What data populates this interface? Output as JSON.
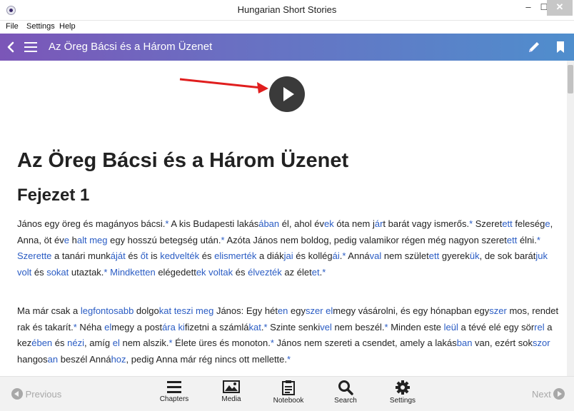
{
  "window": {
    "title": "Hungarian Short Stories",
    "min_glyph": "–",
    "max_glyph": "☐",
    "close_glyph": "✕"
  },
  "menu": {
    "items": [
      "File",
      "Settings",
      "Help"
    ]
  },
  "header": {
    "title": "Az Öreg Bácsi és a Három Üzenet",
    "gradient_start": "#7b56b8",
    "gradient_end": "#4f8ecd"
  },
  "content": {
    "story_title": "Az Öreg Bácsi és a Három Üzenet",
    "chapter_title": "Fejezet 1",
    "paragraphs": [
      [
        {
          "t": "János egy öreg és magányos bácsi."
        },
        {
          "t": "*",
          "h": true
        },
        {
          "t": " A kis Budapesti lakás"
        },
        {
          "t": "ában",
          "h": true
        },
        {
          "t": " él, ahol év"
        },
        {
          "t": "ek",
          "h": true
        },
        {
          "t": " óta nem j"
        },
        {
          "t": "ár",
          "h": true
        },
        {
          "t": "t barát vagy ismerős."
        },
        {
          "t": "*",
          "h": true
        },
        {
          "t": " Szeret"
        },
        {
          "t": "ett",
          "h": true
        },
        {
          "t": " feleség"
        },
        {
          "t": "e",
          "h": true
        },
        {
          "t": ", Anna, öt év"
        },
        {
          "t": "e",
          "h": true
        },
        {
          "t": " h"
        },
        {
          "t": "alt meg",
          "h": true
        },
        {
          "t": " egy hosszú betegség után."
        },
        {
          "t": "*",
          "h": true
        },
        {
          "t": " Azóta János nem boldog, pedig valamikor régen még nagyon"
        },
        {
          "t": " szeret"
        },
        {
          "t": "ett",
          "h": true
        },
        {
          "t": " élni."
        },
        {
          "t": "*",
          "h": true
        },
        {
          "t": " "
        },
        {
          "t": "Szerette",
          "h": true
        },
        {
          "t": " a tanári munk"
        },
        {
          "t": "áját",
          "h": true
        },
        {
          "t": " és "
        },
        {
          "t": "őt",
          "h": true
        },
        {
          "t": " is "
        },
        {
          "t": "kedvelték",
          "h": true
        },
        {
          "t": " és "
        },
        {
          "t": "elismerték",
          "h": true
        },
        {
          "t": " a diák"
        },
        {
          "t": "jai",
          "h": true
        },
        {
          "t": " és kollég"
        },
        {
          "t": "ái",
          "h": true
        },
        {
          "t": "."
        },
        {
          "t": "*",
          "h": true
        },
        {
          "t": " Anná"
        },
        {
          "t": "val",
          "h": true
        },
        {
          "t": " nem szület"
        },
        {
          "t": "ett",
          "h": true
        },
        {
          "t": " gyerek"
        },
        {
          "t": "ük",
          "h": true
        },
        {
          "t": ", de sok barát"
        },
        {
          "t": "juk volt",
          "h": true
        },
        {
          "t": " és "
        },
        {
          "t": "sokat",
          "h": true
        },
        {
          "t": " utaztak."
        },
        {
          "t": "*",
          "h": true
        },
        {
          "t": " "
        },
        {
          "t": "Mindketten",
          "h": true
        },
        {
          "t": " elégedett"
        },
        {
          "t": "ek voltak",
          "h": true
        },
        {
          "t": " és "
        },
        {
          "t": "élvezték",
          "h": true
        },
        {
          "t": " az élet"
        },
        {
          "t": "et",
          "h": true
        },
        {
          "t": "."
        },
        {
          "t": "*",
          "h": true
        }
      ],
      [
        {
          "t": "Ma már csak a "
        },
        {
          "t": "legfontosabb",
          "h": true
        },
        {
          "t": " dolgo"
        },
        {
          "t": "kat teszi meg",
          "h": true
        },
        {
          "t": " János: Egy hét"
        },
        {
          "t": "en",
          "h": true
        },
        {
          "t": " egy"
        },
        {
          "t": "szer el",
          "h": true
        },
        {
          "t": "megy vásárolni, és egy hónapban egy"
        },
        {
          "t": "szer",
          "h": true
        },
        {
          "t": " mos,"
        },
        {
          "t": " rendet rak és takarít."
        },
        {
          "t": "*",
          "h": true
        },
        {
          "t": " Néha "
        },
        {
          "t": "el",
          "h": true
        },
        {
          "t": "megy a post"
        },
        {
          "t": "ára",
          "h": true
        },
        {
          "t": " "
        },
        {
          "t": "ki",
          "h": true
        },
        {
          "t": "fizetni a számlá"
        },
        {
          "t": "kat",
          "h": true
        },
        {
          "t": "."
        },
        {
          "t": "*",
          "h": true
        },
        {
          "t": " Szinte senki"
        },
        {
          "t": "vel",
          "h": true
        },
        {
          "t": " nem beszél."
        },
        {
          "t": "*",
          "h": true
        },
        {
          "t": " Minden este "
        },
        {
          "t": "leül",
          "h": true
        },
        {
          "t": " a tévé elé"
        },
        {
          "t": " egy sör"
        },
        {
          "t": "rel",
          "h": true
        },
        {
          "t": " a kez"
        },
        {
          "t": "ében",
          "h": true
        },
        {
          "t": " és "
        },
        {
          "t": "nézi",
          "h": true
        },
        {
          "t": ", amíg "
        },
        {
          "t": "el",
          "h": true
        },
        {
          "t": " nem alszik."
        },
        {
          "t": "*",
          "h": true
        },
        {
          "t": " Élete üres és monoton."
        },
        {
          "t": "*",
          "h": true
        },
        {
          "t": " János nem szereti a csendet, amely a lakás"
        },
        {
          "t": "ban",
          "h": true
        },
        {
          "t": " van, ezért sok"
        },
        {
          "t": "szor",
          "h": true
        },
        {
          "t": " hangos"
        },
        {
          "t": "an",
          "h": true
        },
        {
          "t": " beszél Anná"
        },
        {
          "t": "hoz",
          "h": true
        },
        {
          "t": ", pedig Anna már rég nincs ott mellette."
        },
        {
          "t": "*",
          "h": true
        }
      ]
    ],
    "highlight_color": "#2a5cc4"
  },
  "bottom": {
    "prev": "Previous",
    "next": "Next",
    "buttons": [
      {
        "label": "Chapters",
        "icon": "hamburger-icon"
      },
      {
        "label": "Media",
        "icon": "image-icon"
      },
      {
        "label": "Notebook",
        "icon": "clipboard-icon"
      },
      {
        "label": "Search",
        "icon": "search-icon"
      },
      {
        "label": "Settings",
        "icon": "gear-icon"
      }
    ]
  }
}
